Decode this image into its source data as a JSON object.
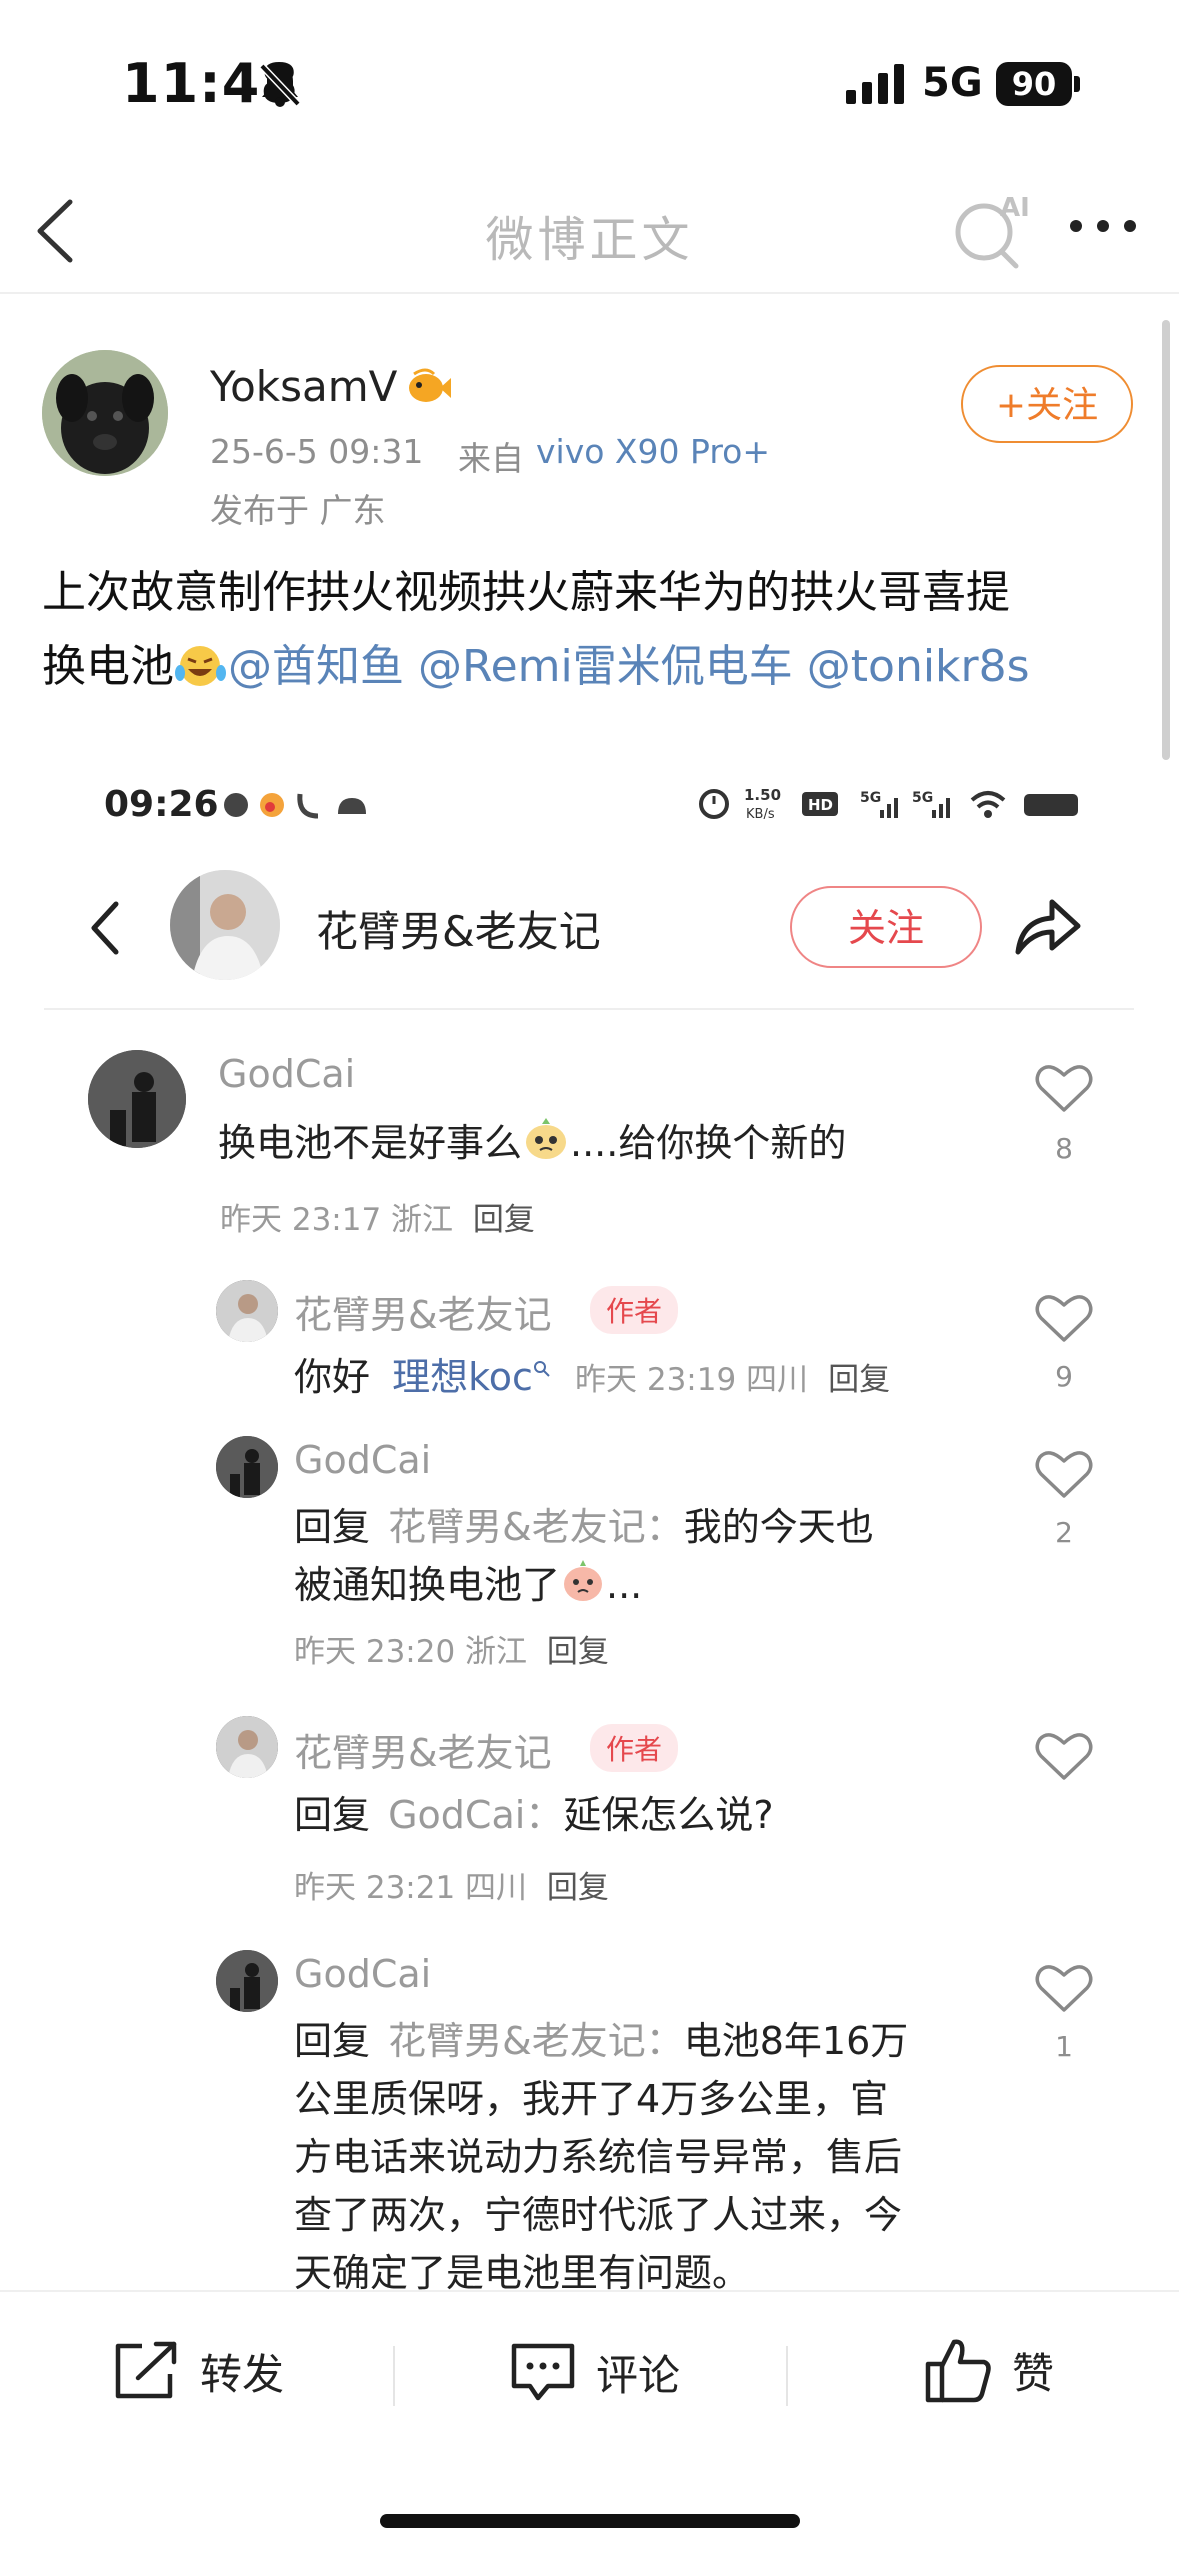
{
  "status_bar": {
    "time": "11:48",
    "network": "5G",
    "battery": "90"
  },
  "header": {
    "title": "微博正文"
  },
  "post": {
    "author": "YoksamV",
    "time": "25-6-5 09:31",
    "via_label": "来自",
    "device": "vivo X90 Pro+",
    "location": "发布于 广东",
    "follow_label": "+关注",
    "text_line1": "上次故意制作拱火视频拱火蔚来华为的拱火哥喜提",
    "text_line2_prefix": "换电池",
    "mentions": [
      "@酋知鱼",
      "@Remi雷米侃电车",
      "@tonikr8s"
    ]
  },
  "embedded": {
    "status_time": "09:26",
    "status_speed": "1.50 KB/s",
    "account_name": "花臂男&老友记",
    "follow_label": "关注",
    "comments": [
      {
        "name": "GodCai",
        "text": "换电池不是好事么",
        "text_suffix": "....给你换个新的",
        "meta": "昨天 23:17 浙江",
        "reply": "回复",
        "likes": "8"
      },
      {
        "name": "花臂男&老友记",
        "tag": "作者",
        "text_prefix": "你好",
        "mention": "理想koc",
        "meta": "昨天 23:19 四川",
        "reply": "回复",
        "likes": "9"
      },
      {
        "name": "GodCai",
        "reply_prefix": "回复",
        "reply_to": "花臂男&老友记：",
        "text": "我的今天也",
        "text_line2": "被通知换电池了",
        "text_suffix": "...",
        "meta": "昨天 23:20 浙江",
        "reply": "回复",
        "likes": "2"
      },
      {
        "name": "花臂男&老友记",
        "tag": "作者",
        "reply_prefix": "回复",
        "reply_to": "GodCai：",
        "text": "延保怎么说?",
        "meta": "昨天 23:21 四川",
        "reply": "回复",
        "likes": ""
      },
      {
        "name": "GodCai",
        "reply_prefix": "回复",
        "reply_to": "花臂男&老友记：",
        "text": "电池8年16万",
        "text_line2": "公里质保呀，我开了4万多公里，官",
        "text_line3": "方电话来说动力系统信号异常，售后",
        "text_line4": "查了两次，宁德时代派了人过来，今",
        "text_line5": "天确定了是电池里有问题。",
        "likes": "1"
      }
    ]
  },
  "bottom_bar": {
    "repost": "转发",
    "comment": "评论",
    "like": "赞"
  },
  "colors": {
    "mention": "#5a84b8",
    "follow_orange": "#ef7c2a",
    "emb_follow_red": "#e5484d"
  }
}
